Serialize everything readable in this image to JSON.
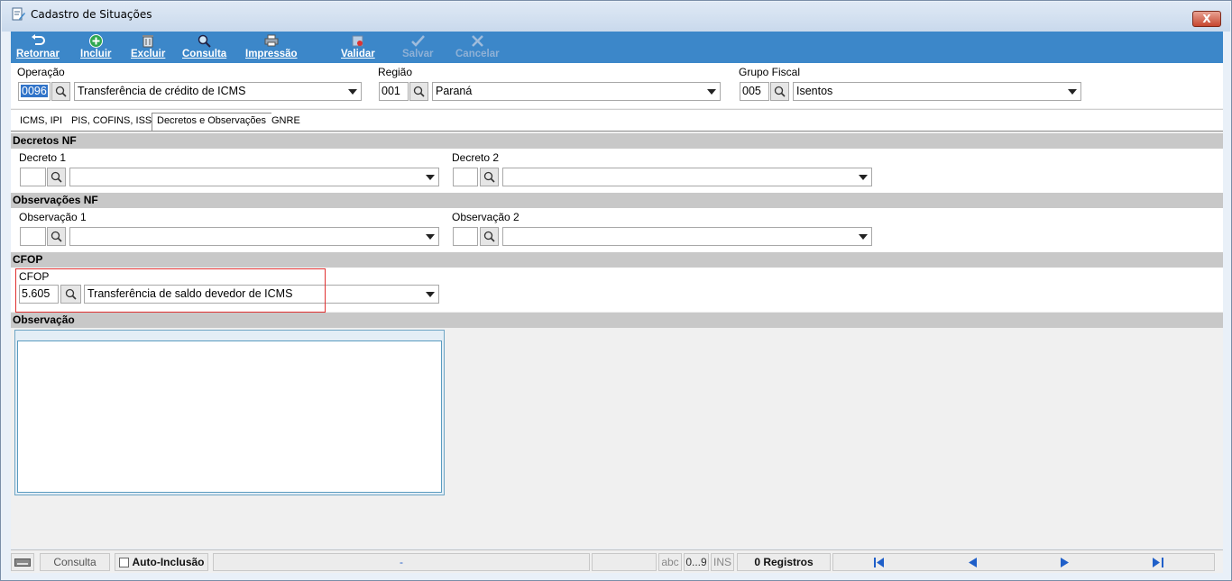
{
  "window": {
    "title": "Cadastro de Situações",
    "close_label": "X"
  },
  "toolbar": {
    "retornar": "Retornar",
    "incluir": "Incluir",
    "excluir": "Excluir",
    "consulta": "Consulta",
    "impressao": "Impressão",
    "validar": "Validar",
    "salvar": "Salvar",
    "cancelar": "Cancelar"
  },
  "header": {
    "operacao": {
      "label": "Operação",
      "code": "0096",
      "value": "Transferência de crédito de ICMS"
    },
    "regiao": {
      "label": "Região",
      "code": "001",
      "value": "Paraná"
    },
    "grupo_fiscal": {
      "label": "Grupo Fiscal",
      "code": "005",
      "value": "Isentos"
    }
  },
  "tabs": [
    {
      "label": "ICMS, IPI"
    },
    {
      "label": "PIS, COFINS, ISS"
    },
    {
      "label": "Decretos e Observações"
    },
    {
      "label": "GNRE"
    }
  ],
  "sections": {
    "decretos": {
      "title": "Decretos NF",
      "decreto1": {
        "label": "Decreto 1",
        "code": "",
        "value": ""
      },
      "decreto2": {
        "label": "Decreto 2",
        "code": "",
        "value": ""
      }
    },
    "observacoes": {
      "title": "Observações NF",
      "obs1": {
        "label": "Observação 1",
        "code": "",
        "value": ""
      },
      "obs2": {
        "label": "Observação 2",
        "code": "",
        "value": ""
      }
    },
    "cfop": {
      "title": "CFOP",
      "label": "CFOP",
      "code": "5.605",
      "value": "Transferência de saldo devedor de ICMS"
    },
    "observacao": {
      "title": "Observação",
      "text": ""
    }
  },
  "statusbar": {
    "mode": "Consulta",
    "auto_inclusao": "Auto-Inclusão",
    "center": "-",
    "abc": "abc",
    "digits": "0...9",
    "ins": "INS",
    "registros": "0 Registros"
  },
  "colors": {
    "toolbar_bg": "#3c87c9",
    "highlight_red": "#e03030",
    "section_gray": "#c8c8c8"
  }
}
